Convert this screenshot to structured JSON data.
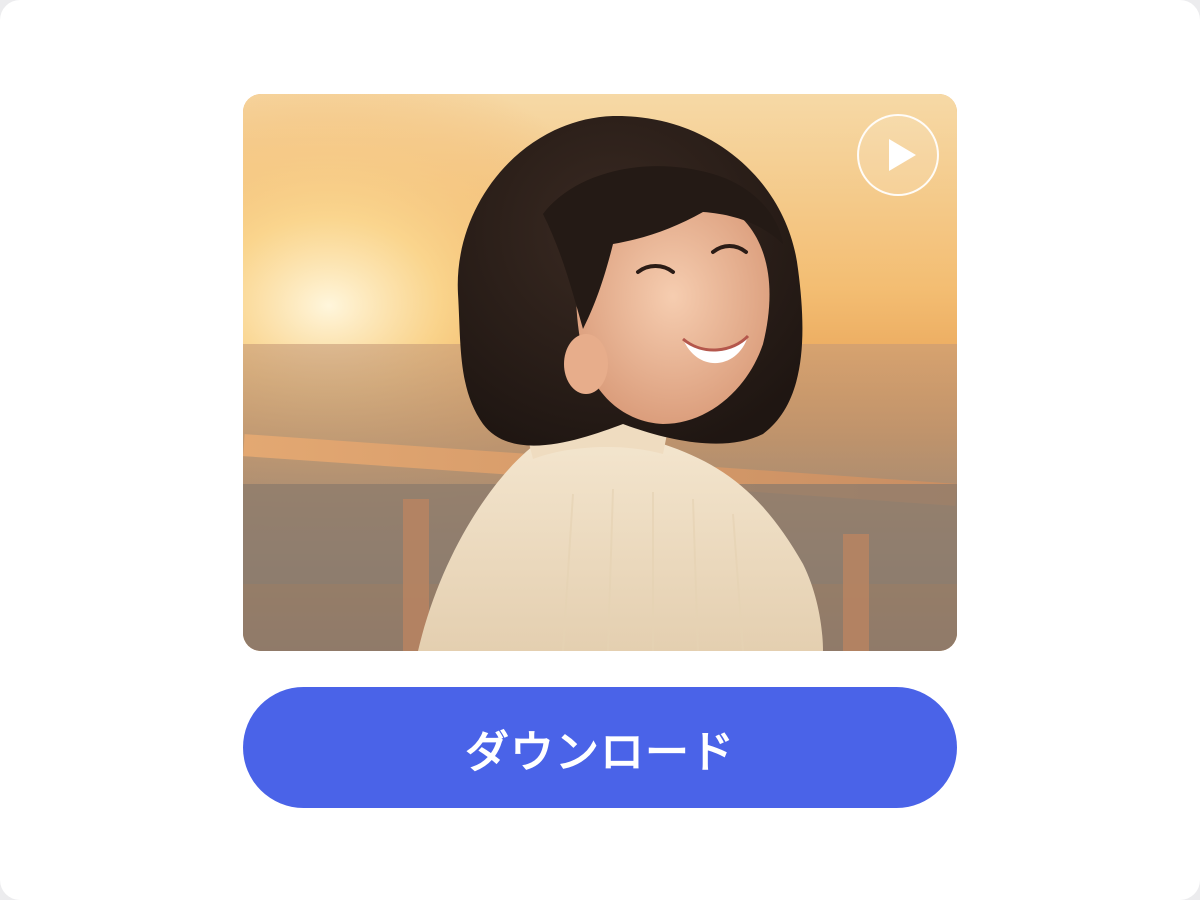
{
  "media": {
    "kind": "video-preview",
    "play_icon": "play-icon"
  },
  "actions": {
    "download_label": "ダウンロード"
  },
  "colors": {
    "download_button": "#4a63e8",
    "page_background": "#ffffff",
    "play_ring": "#ffffff"
  }
}
